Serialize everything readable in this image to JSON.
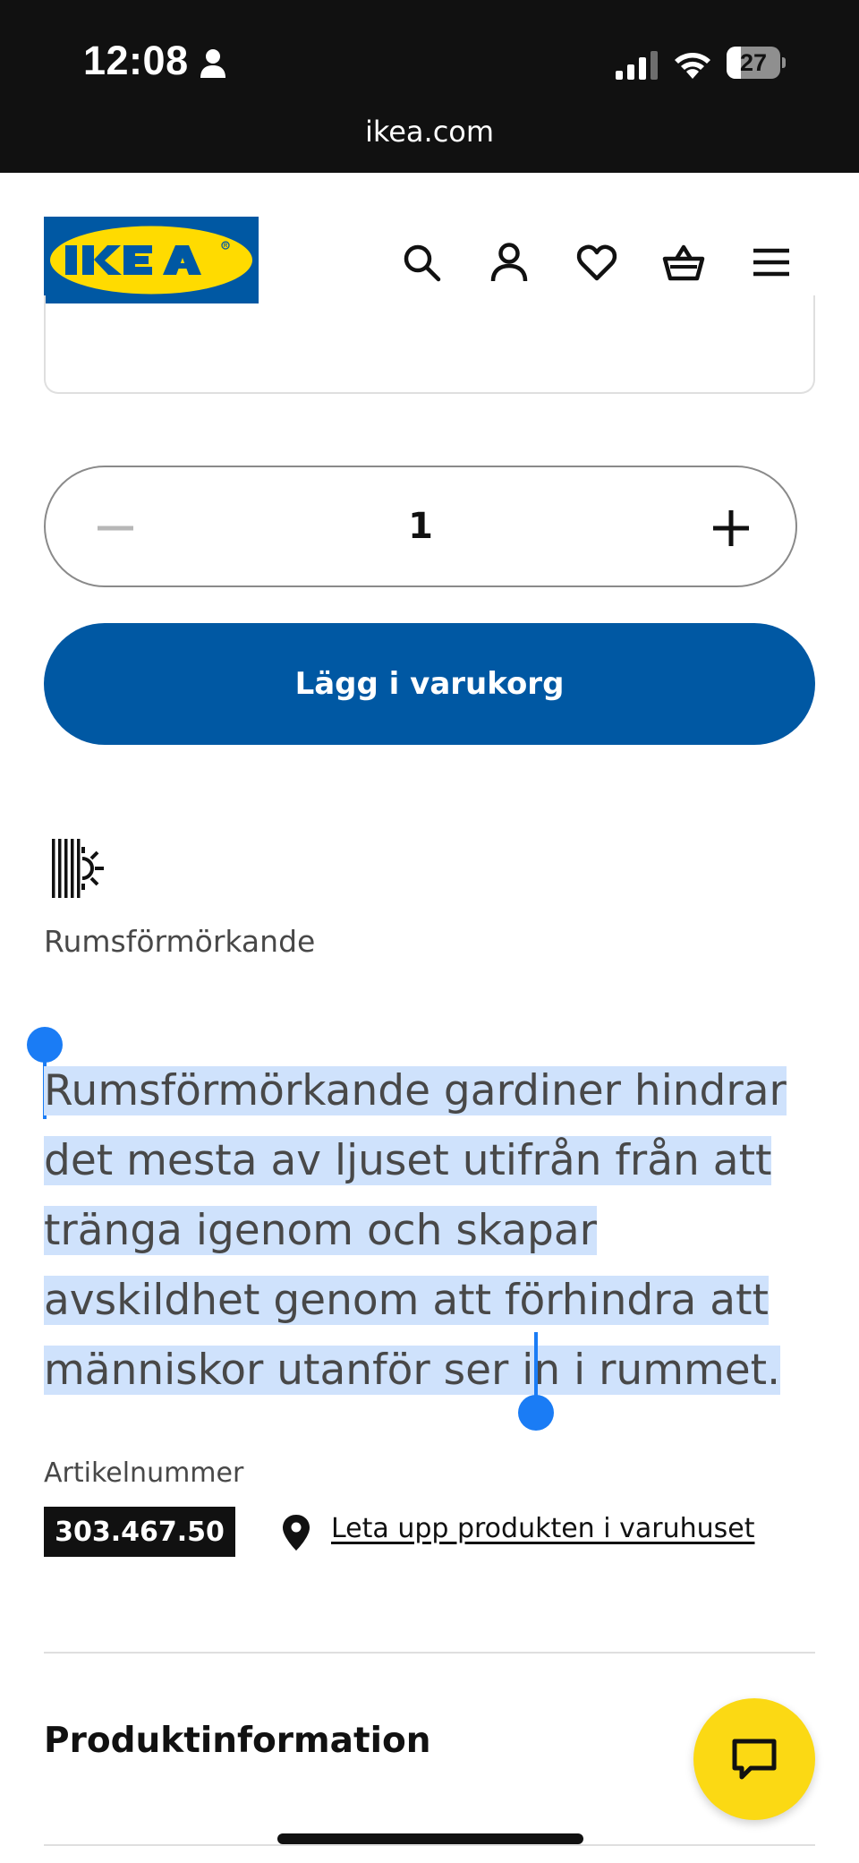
{
  "status_bar": {
    "time": "12:08",
    "battery_percent": 27,
    "battery_text": "27",
    "url": "ikea.com"
  },
  "header": {
    "logo_text": "IKEA",
    "icons": [
      "search-icon",
      "user-icon",
      "heart-icon",
      "basket-icon",
      "menu-icon"
    ],
    "logo_colors": {
      "blue": "#0058a3",
      "yellow": "#ffdb00"
    }
  },
  "quantity": {
    "value": "1"
  },
  "add_to_cart": {
    "label": "Lägg i varukorg",
    "color": "#0058a3"
  },
  "feature": {
    "icon": "room-darkening-icon",
    "label": "Rumsförmörkande"
  },
  "description": {
    "text": "Rumsförmörkande gardiner hindrar det mesta av ljuset utifrån från att tränga igenom och skapar avskildhet genom att förhindra att människor utanför ser in i rummet.",
    "selection_color": "#cfe2fc"
  },
  "article": {
    "label": "Artikelnummer",
    "number": "303.467.50"
  },
  "store_link": {
    "label": "Leta upp produkten i varuhuset"
  },
  "sections": {
    "product_info": "Produktinformation"
  },
  "chat": {
    "icon": "chat-icon",
    "color": "#fbd914"
  }
}
